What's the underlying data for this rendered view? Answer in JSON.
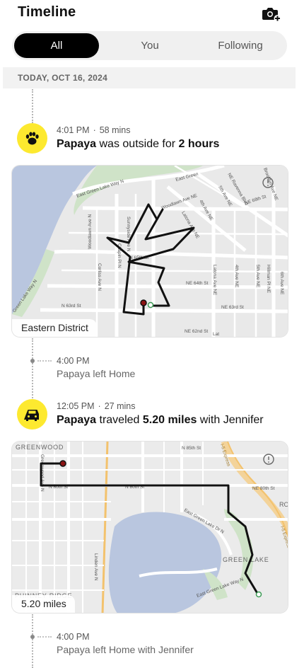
{
  "header": {
    "title": "Timeline",
    "camera_icon": "camera-add-icon"
  },
  "tabs": [
    {
      "label": "All",
      "selected": true
    },
    {
      "label": "You",
      "selected": false
    },
    {
      "label": "Following",
      "selected": false
    }
  ],
  "date_header": "TODAY, OCT 16, 2024",
  "events": [
    {
      "icon": "paw-icon",
      "time": "4:01 PM",
      "duration": "58 mins",
      "title_parts": [
        "Papaya",
        " was outside for ",
        "2 hours"
      ],
      "map": {
        "label": "Eastern District",
        "streets": [
          "East Green Lake Way N",
          "East Green",
          "Woodlawn Ave N",
          "Chapin Pl N",
          "Sunnyside Ave N",
          "Woodlawn Ave NE",
          "Latona Ave NE",
          "4th Ave NE",
          "5th Ave NE",
          "NE Ravenna Blvd",
          "NE 68th St",
          "NE 65th St",
          "N 65th St",
          "NE 64th St",
          "N 63rd St",
          "NE 63rd St",
          "NE 62nd St",
          "Corliss Ave N",
          "Latona Ave NE",
          "4th Ave NE",
          "5th Ave NE",
          "Hillman Pl NE",
          "6th Ave NE",
          "Green Lake Way N",
          "Brooklyn Ave NE",
          "Lat"
        ]
      },
      "sub": {
        "time": "4:00 PM",
        "text": "Papaya left Home"
      }
    },
    {
      "icon": "car-icon",
      "time": "12:05 PM",
      "duration": "27 mins",
      "title_parts": [
        "Papaya",
        " traveled ",
        "5.20 miles",
        " with Jennifer"
      ],
      "map": {
        "label": "5.20 miles",
        "streets": [
          "GREENWOOD",
          "N 85th St",
          "I-5 Express",
          "NE 80th St",
          "N 80th St",
          "N 80th St",
          "East Green Lake Dr N",
          "Linden Ave N",
          "GREEN LAKE",
          "East Green Lake Way N",
          "I-5 Express",
          "PHINNEY RIDGE",
          "Greenwood Ave N",
          "RO"
        ]
      },
      "sub": {
        "time": "4:00 PM",
        "text": "Papaya left Home with Jennifer"
      }
    }
  ]
}
